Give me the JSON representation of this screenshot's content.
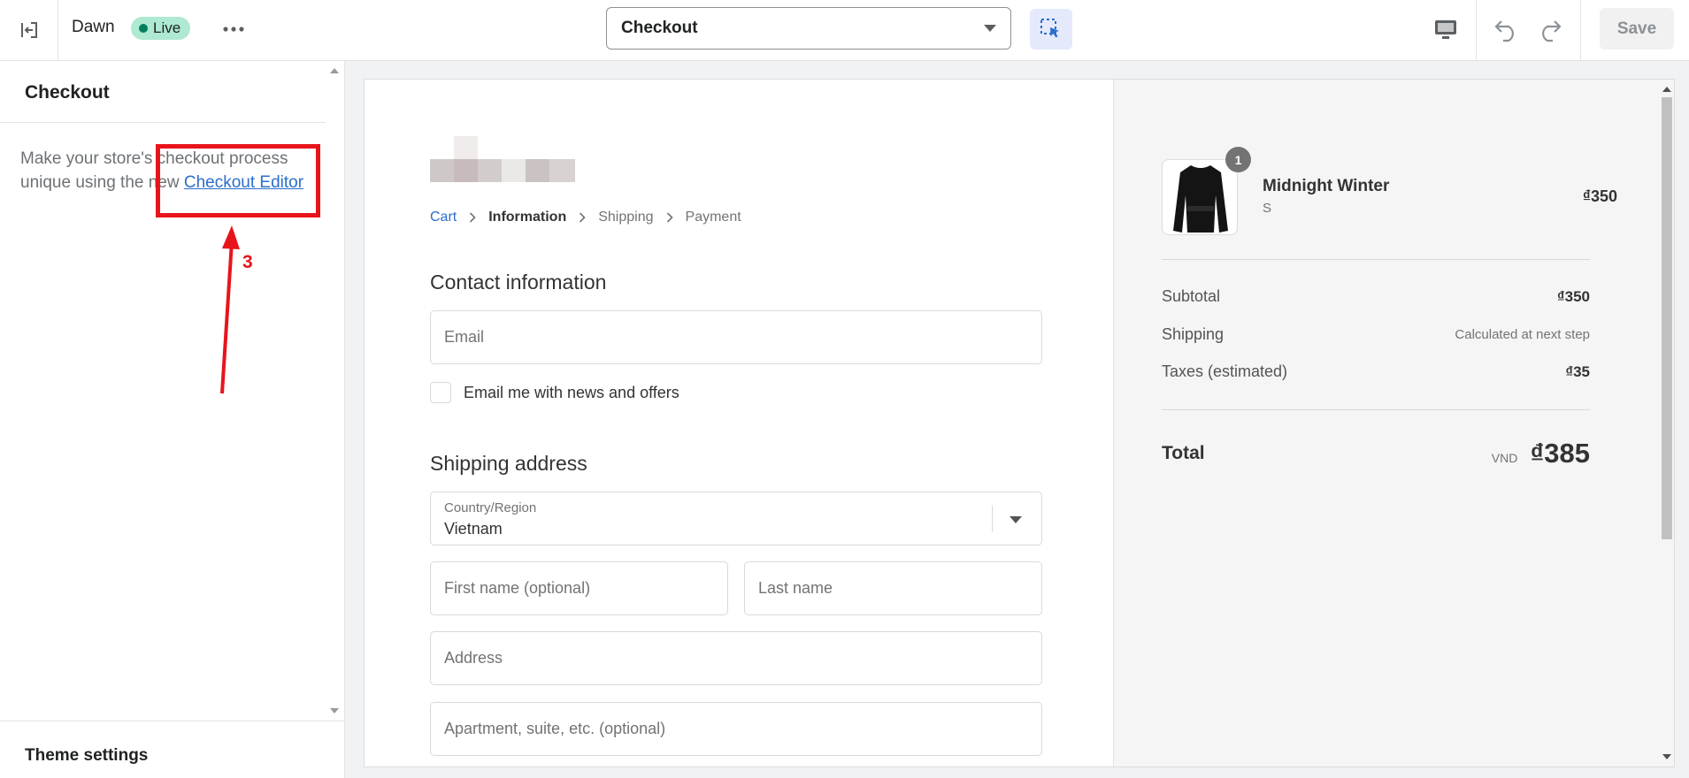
{
  "topbar": {
    "theme_name": "Dawn",
    "status_badge": "Live",
    "page_selector": "Checkout",
    "save_label": "Save"
  },
  "sidebar": {
    "title": "Checkout",
    "description_prefix": "Make your store's checkout process unique using the new ",
    "link_text": "Checkout Editor",
    "theme_settings": "Theme settings"
  },
  "annotation": {
    "step_number": "3",
    "color": "#e8141c"
  },
  "checkout": {
    "breadcrumb": {
      "cart": "Cart",
      "information": "Information",
      "shipping": "Shipping",
      "payment": "Payment"
    },
    "contact": {
      "title": "Contact information",
      "email_placeholder": "Email",
      "newsletter_label": "Email me with news and offers"
    },
    "shipping": {
      "title": "Shipping address",
      "country_label": "Country/Region",
      "country_value": "Vietnam",
      "first_name_placeholder": "First name (optional)",
      "last_name_placeholder": "Last name",
      "address_placeholder": "Address",
      "apartment_placeholder": "Apartment, suite, etc. (optional)"
    }
  },
  "summary": {
    "product": {
      "name": "Midnight Winter",
      "variant": "S",
      "price": "₫350",
      "quantity": "1"
    },
    "subtotal_label": "Subtotal",
    "subtotal_value": "₫350",
    "shipping_label": "Shipping",
    "shipping_value": "Calculated at next step",
    "taxes_label": "Taxes (estimated)",
    "taxes_value": "₫35",
    "total_label": "Total",
    "currency": "VND",
    "total_value": "₫385"
  },
  "colors": {
    "link": "#2c6ecb",
    "live_badge": "#aee9d1",
    "inspector_bg": "#e4e9fb"
  }
}
